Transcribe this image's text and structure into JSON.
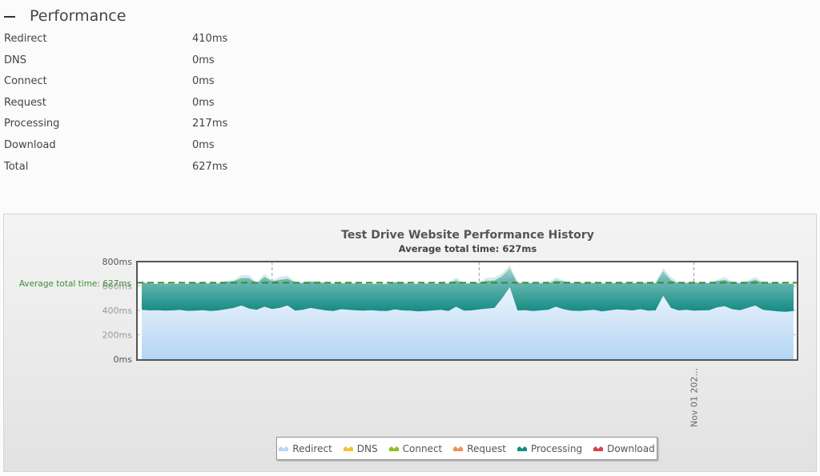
{
  "section": {
    "title": "Performance",
    "collapse_icon": "minus-icon"
  },
  "metrics": [
    {
      "label": "Redirect",
      "value": "410ms"
    },
    {
      "label": "DNS",
      "value": "0ms"
    },
    {
      "label": "Connect",
      "value": "0ms"
    },
    {
      "label": "Request",
      "value": "0ms"
    },
    {
      "label": "Processing",
      "value": "217ms"
    },
    {
      "label": "Download",
      "value": "0ms"
    },
    {
      "label": "Total",
      "value": "627ms"
    }
  ],
  "chart_data": {
    "type": "area",
    "stacked": true,
    "title": "Test Drive Website Performance History",
    "subtitle": "Average total time: 627ms",
    "xlabel": "",
    "ylabel": "",
    "ylim": [
      0,
      800
    ],
    "yticks": [
      "0ms",
      "200ms",
      "400ms",
      "600ms",
      "800ms"
    ],
    "ytick_values": [
      0,
      200,
      400,
      600,
      800
    ],
    "xtick_labels": [
      {
        "label": "Nov 01 202...",
        "index": 72
      }
    ],
    "vertical_gridline_indices": [
      17,
      44,
      72
    ],
    "grid": true,
    "legend_position": "bottom",
    "average_line": {
      "label": "Average total time: 627ms",
      "value": 627,
      "color": "#3a8a2e"
    },
    "series": [
      {
        "name": "Redirect",
        "color": "#a9cdee",
        "values": [
          405,
          400,
          402,
          398,
          400,
          404,
          396,
          398,
          402,
          395,
          400,
          410,
          420,
          440,
          415,
          405,
          430,
          412,
          420,
          440,
          398,
          405,
          420,
          410,
          400,
          395,
          410,
          405,
          400,
          398,
          402,
          396,
          395,
          408,
          400,
          398,
          392,
          395,
          400,
          405,
          395,
          430,
          398,
          400,
          408,
          415,
          420,
          500,
          590,
          400,
          402,
          395,
          400,
          405,
          430,
          410,
          398,
          395,
          400,
          405,
          392,
          400,
          408,
          405,
          400,
          410,
          398,
          400,
          520,
          420,
          400,
          405,
          398,
          400,
          402,
          425,
          435,
          410,
          402,
          420,
          440,
          405,
          398,
          392,
          388,
          395
        ]
      },
      {
        "name": "DNS",
        "color": "#f2c233",
        "values": [
          0,
          0,
          0,
          0,
          0,
          0,
          0,
          0,
          0,
          0,
          0,
          0,
          0,
          0,
          0,
          0,
          0,
          0,
          0,
          0,
          0,
          0,
          0,
          0,
          0,
          0,
          0,
          0,
          0,
          0,
          0,
          0,
          0,
          0,
          0,
          0,
          0,
          0,
          0,
          0,
          0,
          0,
          0,
          0,
          0,
          0,
          0,
          0,
          0,
          0,
          0,
          0,
          0,
          0,
          0,
          0,
          0,
          0,
          0,
          0,
          0,
          0,
          0,
          0,
          0,
          0,
          0,
          0,
          0,
          0,
          0,
          0,
          0,
          0,
          0,
          0,
          0,
          0,
          0,
          0,
          0,
          0,
          0,
          0,
          0,
          0
        ]
      },
      {
        "name": "Connect",
        "color": "#8cbf26",
        "values": [
          0,
          0,
          0,
          0,
          0,
          0,
          0,
          0,
          0,
          0,
          0,
          0,
          0,
          0,
          0,
          0,
          0,
          0,
          0,
          0,
          0,
          0,
          0,
          0,
          0,
          0,
          0,
          0,
          0,
          0,
          0,
          0,
          0,
          0,
          0,
          0,
          0,
          0,
          0,
          0,
          0,
          0,
          0,
          0,
          0,
          0,
          0,
          0,
          0,
          0,
          0,
          0,
          0,
          0,
          0,
          0,
          0,
          0,
          0,
          0,
          0,
          0,
          0,
          0,
          0,
          0,
          0,
          0,
          0,
          0,
          0,
          0,
          0,
          0,
          0,
          0,
          0,
          0,
          0,
          0,
          0,
          0,
          0,
          0,
          0,
          0
        ]
      },
      {
        "name": "Request",
        "color": "#f0925a",
        "values": [
          0,
          0,
          0,
          0,
          0,
          0,
          0,
          0,
          0,
          0,
          0,
          0,
          0,
          0,
          0,
          0,
          0,
          0,
          0,
          0,
          0,
          0,
          0,
          0,
          0,
          0,
          0,
          0,
          0,
          0,
          0,
          0,
          0,
          0,
          0,
          0,
          0,
          0,
          0,
          0,
          0,
          0,
          0,
          0,
          0,
          0,
          0,
          0,
          0,
          0,
          0,
          0,
          0,
          0,
          0,
          0,
          0,
          0,
          0,
          0,
          0,
          0,
          0,
          0,
          0,
          0,
          0,
          0,
          0,
          0,
          0,
          0,
          0,
          0,
          0,
          0,
          0,
          0,
          0,
          0,
          0,
          0,
          0,
          0,
          0,
          0
        ]
      },
      {
        "name": "Processing",
        "color": "#168f89",
        "values": [
          225,
          218,
          215,
          220,
          218,
          214,
          222,
          226,
          218,
          225,
          220,
          225,
          220,
          225,
          250,
          215,
          245,
          228,
          230,
          220,
          232,
          218,
          215,
          222,
          222,
          224,
          212,
          215,
          220,
          220,
          215,
          222,
          220,
          222,
          222,
          220,
          225,
          225,
          218,
          215,
          225,
          215,
          220,
          222,
          216,
          228,
          225,
          180,
          155,
          225,
          222,
          228,
          222,
          215,
          215,
          228,
          225,
          230,
          224,
          220,
          228,
          222,
          216,
          218,
          222,
          215,
          226,
          222,
          200,
          228,
          222,
          220,
          228,
          225,
          220,
          215,
          215,
          218,
          220,
          215,
          210,
          222,
          225,
          228,
          230,
          222
        ]
      },
      {
        "name": "Download",
        "color": "#d9434d",
        "values": [
          0,
          0,
          0,
          0,
          0,
          0,
          0,
          0,
          0,
          0,
          0,
          0,
          0,
          0,
          0,
          0,
          0,
          0,
          0,
          0,
          0,
          0,
          0,
          0,
          0,
          0,
          0,
          0,
          0,
          0,
          0,
          0,
          0,
          0,
          0,
          0,
          0,
          0,
          0,
          0,
          0,
          0,
          0,
          0,
          0,
          0,
          0,
          0,
          0,
          0,
          0,
          0,
          0,
          0,
          0,
          0,
          0,
          0,
          0,
          0,
          0,
          0,
          0,
          0,
          0,
          0,
          0,
          0,
          0,
          0,
          0,
          0,
          0,
          0,
          0,
          0,
          0,
          0,
          0,
          0,
          0,
          0,
          0,
          0,
          0,
          0
        ]
      }
    ]
  }
}
